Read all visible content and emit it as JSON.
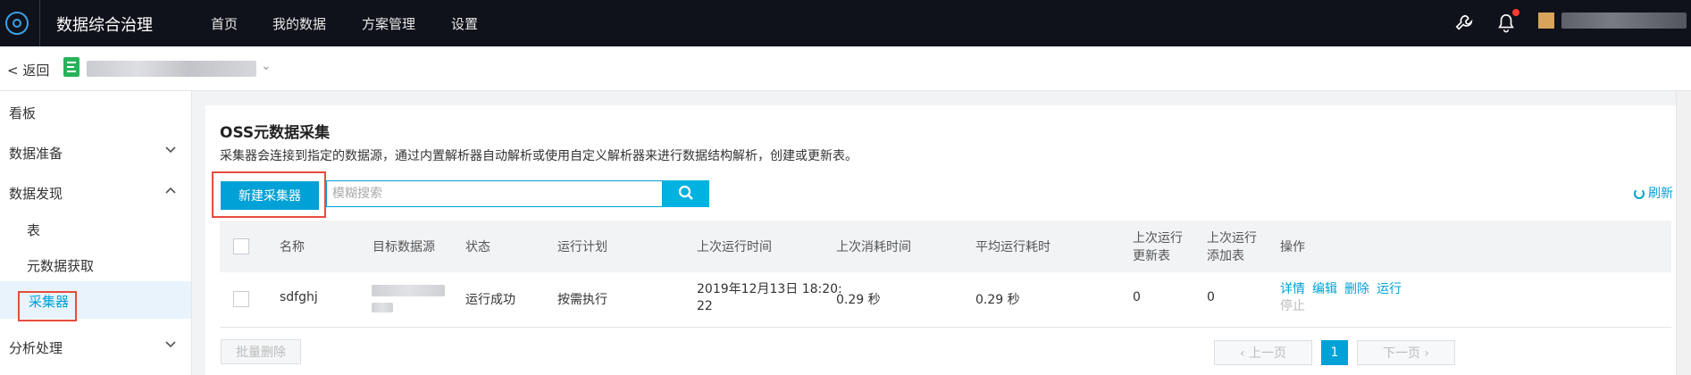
{
  "app": {
    "title": "数据综合治理"
  },
  "nav": {
    "items": [
      "首页",
      "我的数据",
      "方案管理",
      "设置"
    ]
  },
  "subbar": {
    "back_label": "< 返回"
  },
  "sidebar": {
    "items": [
      {
        "label": "看板"
      },
      {
        "label": "数据准备"
      },
      {
        "label": "数据发现"
      },
      {
        "label": "表"
      },
      {
        "label": "元数据获取"
      },
      {
        "label": "采集器"
      },
      {
        "label": "分析处理"
      }
    ]
  },
  "main": {
    "title": "OSS元数据采集",
    "description": "采集器会连接到指定的数据源，通过内置解析器自动解析或使用自定义解析器来进行数据结构解析，创建或更新表。",
    "new_button": "新建采集器",
    "search_placeholder": "模糊搜索",
    "refresh_label": "刷新",
    "table": {
      "headers": {
        "name": "名称",
        "target": "目标数据源",
        "status": "状态",
        "schedule": "运行计划",
        "last_run": "上次运行时间",
        "last_cost": "上次消耗时间",
        "avg_cost": "平均运行耗时",
        "upd_1": "上次运行",
        "upd_2": "更新表",
        "add_1": "上次运行",
        "add_2": "添加表",
        "ops": "操作"
      },
      "rows": [
        {
          "name": "sdfghj",
          "status": "运行成功",
          "schedule": "按需执行",
          "last_run_1": "2019年12月13日 18:20:",
          "last_run_2": "22",
          "last_cost": "0.29 秒",
          "avg_cost": "0.29 秒",
          "updated": "0",
          "added": "0",
          "ops": [
            "详情",
            "编辑",
            "删除",
            "运行"
          ],
          "ops_disabled": [
            "停止"
          ]
        }
      ]
    },
    "batch_delete": "批量删除",
    "pagination": {
      "prev": "上一页",
      "current": "1",
      "next": "下一页"
    }
  },
  "colors": {
    "accent": "#00a1d6",
    "topbar": "#0f121a",
    "highlight_box": "#e74c3c"
  }
}
